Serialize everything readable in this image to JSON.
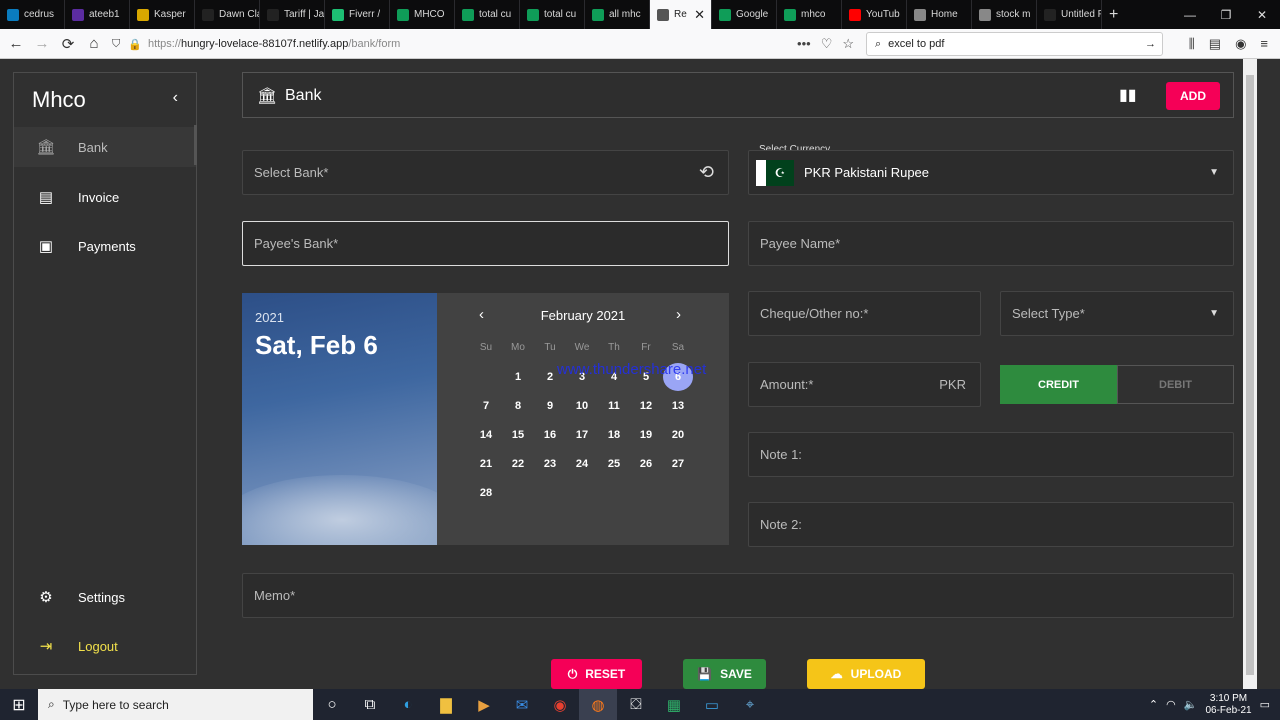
{
  "browser": {
    "tabs": [
      {
        "label": "cedrus",
        "color": "#0a7cbf"
      },
      {
        "label": "ateeb1",
        "color": "#5b2ca0"
      },
      {
        "label": "Kasper",
        "color": "#d9a800"
      },
      {
        "label": "Dawn Class",
        "color": "#222"
      },
      {
        "label": "Tariff | Jang",
        "color": "#222"
      },
      {
        "label": "Fiverr /",
        "color": "#1dbf73"
      },
      {
        "label": "MHCO",
        "color": "#0f9d58"
      },
      {
        "label": "total cu",
        "color": "#0f9d58"
      },
      {
        "label": "total cu",
        "color": "#0f9d58"
      },
      {
        "label": "all mhc",
        "color": "#0f9d58"
      },
      {
        "label": "Re",
        "color": "#555",
        "active": true
      },
      {
        "label": "Google",
        "color": "#0f9d58"
      },
      {
        "label": "mhco",
        "color": "#0f9d58"
      },
      {
        "label": "YouTub",
        "color": "#ff0000"
      },
      {
        "label": "Home",
        "color": "#888"
      },
      {
        "label": "stock m",
        "color": "#888"
      },
      {
        "label": "Untitled Pa",
        "color": "#222"
      }
    ],
    "url_prefix": "https://",
    "url_host": "hungry-lovelace-88107f.netlify.app",
    "url_path": "/bank/form",
    "search_text": "excel to pdf"
  },
  "sidebar": {
    "brand": "Mhco",
    "items": [
      {
        "label": "Bank",
        "icon": "bank-icon"
      },
      {
        "label": "Invoice",
        "icon": "invoice-icon"
      },
      {
        "label": "Payments",
        "icon": "payments-icon"
      }
    ],
    "settings": "Settings",
    "logout": "Logout"
  },
  "header": {
    "title": "Bank",
    "add_label": "ADD"
  },
  "form": {
    "select_bank": "Select Bank*",
    "currency_label": "Select Currency",
    "currency_value": "PKR Pakistani Rupee",
    "payees_bank": "Payee's Bank*",
    "payee_name": "Payee Name*",
    "cheque_no": "Cheque/Other no:*",
    "select_type": "Select Type*",
    "amount": "Amount:*",
    "amount_currency": "PKR",
    "credit": "CREDIT",
    "debit": "DEBIT",
    "note1": "Note 1:",
    "note2": "Note 2:",
    "memo": "Memo*"
  },
  "datepicker": {
    "year": "2021",
    "selected_date": "Sat, Feb 6",
    "month_label": "February 2021",
    "weekdays": [
      "Su",
      "Mo",
      "Tu",
      "We",
      "Th",
      "Fr",
      "Sa"
    ],
    "first_weekday_index": 1,
    "days_in_month": 28,
    "selected_day": 6,
    "watermark": "www.thundershare.net"
  },
  "actions": {
    "reset": "RESET",
    "save": "SAVE",
    "upload": "UPLOAD"
  },
  "colors": {
    "accent_pink": "#f50057",
    "credit_green": "#2e8b3e",
    "save_green": "#2e8b3e",
    "upload_yellow": "#f5c518",
    "logout_yellow": "#f1e04b"
  },
  "taskbar": {
    "search_placeholder": "Type here to search",
    "time": "3:10 PM",
    "date": "06-Feb-21"
  }
}
